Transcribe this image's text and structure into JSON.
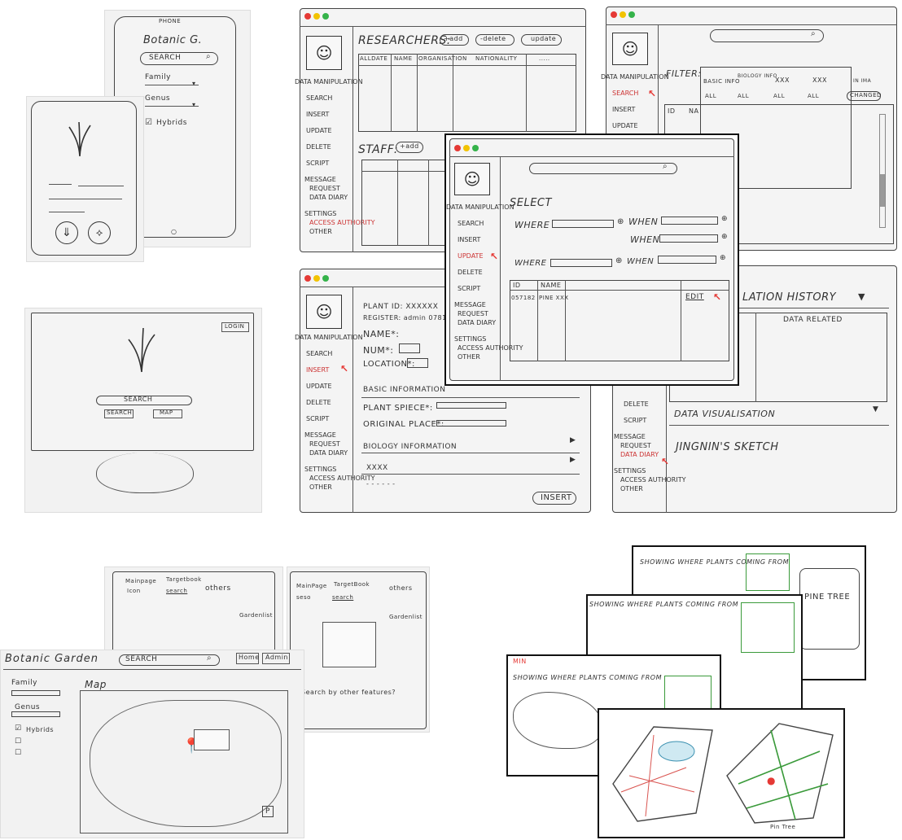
{
  "phone": {
    "title": "PHONE",
    "app_title": "Botanic G.",
    "search": "SEARCH",
    "family": "Family",
    "genus": "Genus",
    "hybrids": "Hybrids"
  },
  "desktop": {
    "login": "LOGIN",
    "search": "SEARCH",
    "search_btn": "SEARCH",
    "map_btn": "MAP"
  },
  "sidebar": {
    "section_data": "DATA MANIPULATION",
    "search": "SEARCH",
    "insert": "INSERT",
    "update": "UPDATE",
    "delete": "DELETE",
    "script": "SCRIPT",
    "section_message": "MESSAGE",
    "request": "REQUEST",
    "data_diary": "DATA DIARY",
    "section_settings": "SETTINGS",
    "access_authority": "ACCESS AUTHORITY",
    "other": "OTHER"
  },
  "researchers": {
    "title": "RESEARCHERS:",
    "add": "+add",
    "delete": "-delete",
    "update": "update",
    "cols": [
      "ALLDATE",
      "NAME",
      "ORGANISATION",
      "NATIONALITY",
      "....."
    ],
    "staff": "STAFF:",
    "staff_add": "+add"
  },
  "search_window": {
    "filter": "FILTER:",
    "cols": [
      "BASIC INFO",
      "BIOLOGY INFO",
      "XXX",
      "XXX"
    ],
    "row1": [
      "ALL",
      "ALL",
      "ALL",
      "ALL"
    ],
    "id": "ID",
    "name": "NA",
    "in_ima": "IN IMA",
    "changed": "CHANGED"
  },
  "select_window": {
    "select": "SELECT",
    "where": "WHERE",
    "when": "WHEN",
    "when2": "WHEN",
    "where2": "WHERE",
    "when3": "WHEN",
    "col_id": "ID",
    "col_name": "NAME",
    "row_id": "057182",
    "row_name": "PINE XXX",
    "edit": "EDIT"
  },
  "insert_window": {
    "plant_id": "PLANT ID: XXXXXX",
    "register": "REGISTER: admin 0781",
    "name": "NAME*:",
    "num": "NUM*:",
    "location": "LOCATION*:",
    "basic": "BASIC INFORMATION",
    "species": "PLANT SPIECE*:",
    "origin": "ORIGINAL PLACE*:",
    "biology": "BIOLOGY INFORMATION",
    "xxx": "XXXX",
    "dashes": "- - - - - -",
    "insert_btn": "INSERT"
  },
  "viz_window": {
    "history": "LATION HISTORY",
    "data_related": "DATA RELATED",
    "visualisation": "DATA VISUALISATION",
    "sketch": "JINGNIN'S SKETCH"
  },
  "map_page": {
    "title": "Botanic Garden",
    "search": "SEARCH",
    "home": "Home",
    "admin": "Admin",
    "family": "Family",
    "genus": "Genus",
    "hybrids": "Hybrids",
    "map": "Map",
    "nav1": "Mainpage",
    "nav2": "Targetbook",
    "nav3": "others",
    "nav4": "Icon",
    "nav5": "search",
    "garden": "Gardenlist",
    "garden2": "Gardenlist",
    "tips": "Search by other features?",
    "nav6": "MainPage",
    "nav7": "TargetBook",
    "nav8": "others",
    "nav9": "seso",
    "nav10": "search"
  },
  "maps": {
    "caption": "SHOWING WHERE PLANTS COMING FROM",
    "pine": "PINE TREE",
    "tree": "Pin Tree"
  }
}
